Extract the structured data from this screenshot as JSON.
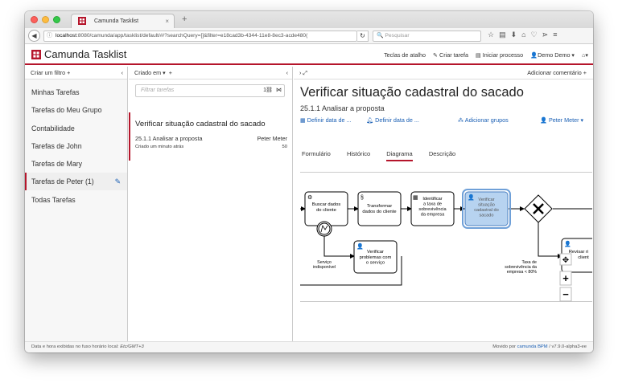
{
  "browser": {
    "tab_title": "Camunda Tasklist",
    "tab_close": "×",
    "new_tab": "+",
    "url_host": "localhost",
    "url_rest": ":8080/camunda/app/tasklist/default/#/?searchQuery=[]&filter=e18cad3b-4344-11e8-8ec3-acde480(",
    "search_placeholder": "Pesquisar"
  },
  "header": {
    "brand": "Camunda Tasklist",
    "shortcuts": "Teclas de atalho",
    "create_task": "Criar tarefa",
    "start_process": "Iniciar processo",
    "user": "Demo Demo"
  },
  "filters": {
    "create_label": "Criar um filtro",
    "items": [
      {
        "label": "Minhas Tarefas"
      },
      {
        "label": "Tarefas do Meu Grupo"
      },
      {
        "label": "Contabilidade"
      },
      {
        "label": "Tarefas de John"
      },
      {
        "label": "Tarefas de Mary"
      },
      {
        "label": "Tarefas de Peter (1)"
      },
      {
        "label": "Todas Tarefas"
      }
    ]
  },
  "tasklist": {
    "sort_label": "Criado em",
    "filter_placeholder": "Filtrar tarefas",
    "count": "1",
    "task": {
      "name": "Verificar situação cadastral do sacado",
      "process": "25.1.1 Analisar a proposta",
      "assignee": "Peter Meter",
      "created": "Criado um minuto atrás",
      "priority": "50"
    }
  },
  "detail": {
    "add_comment": "Adicionar comentário",
    "title": "Verificar situação cadastral do sacado",
    "process": "25.1.1 Analisar a proposta",
    "follow_up": "Definir data de ...",
    "due_date": "Definir data de ...",
    "add_groups": "Adicionar grupos",
    "assignee": "Peter Meter",
    "tabs": [
      "Formulário",
      "Histórico",
      "Diagrama",
      "Descrição"
    ]
  },
  "diagram": {
    "t1": [
      "Buscar dados",
      "do cliente"
    ],
    "t2": [
      "Transformar",
      "dados do cliente"
    ],
    "t3": [
      "Identificar",
      "a taxa de",
      "sobrevivência",
      "da empresa"
    ],
    "t4": [
      "Verificar",
      "situação",
      "cadastral do",
      "sacado"
    ],
    "t5": [
      "Verificar",
      "problemas com",
      "o serviço"
    ],
    "t6": [
      "Revisar ri",
      "client"
    ],
    "error_label": [
      "Serviço",
      "indisponível"
    ],
    "cond_label": [
      "Taxa de",
      "sobrevivência da",
      "empresa < 80%"
    ],
    "zoom_in": "+",
    "zoom_out": "−"
  },
  "footer": {
    "timezone_text": "Data e hora exibidas no fuso horário local:",
    "timezone": "Etc/GMT+3",
    "powered_text": "Movido por",
    "powered_link": "camunda BPM",
    "version": "/ v7.9.0-alpha3-ee"
  },
  "colors": {
    "accent": "#b5152b",
    "link": "#1a5fb4",
    "active_task": "#b7d3f0"
  }
}
